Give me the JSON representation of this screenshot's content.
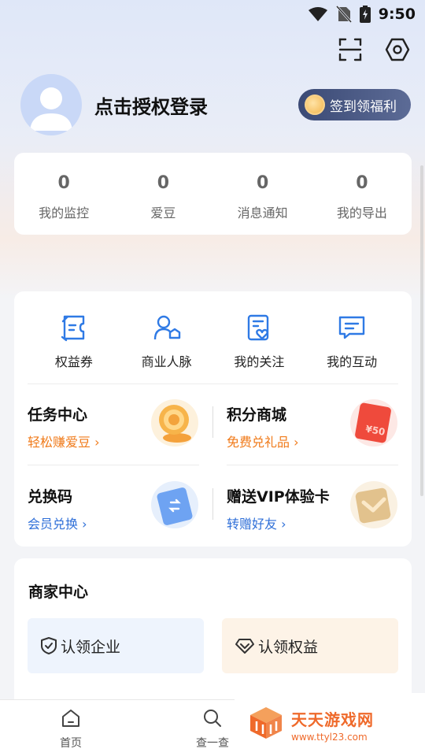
{
  "status_bar": {
    "time": "9:50",
    "icons": [
      "wifi-icon",
      "no-sim-icon",
      "battery-icon"
    ]
  },
  "header": {
    "icons": [
      "scan-icon",
      "settings-icon"
    ],
    "login_text": "点击授权登录",
    "signin_label": "签到领福利"
  },
  "stats": [
    {
      "value": "0",
      "label": "我的监控"
    },
    {
      "value": "0",
      "label": "爱豆"
    },
    {
      "value": "0",
      "label": "消息通知"
    },
    {
      "value": "0",
      "label": "我的导出"
    }
  ],
  "quick_actions": [
    {
      "label": "权益券",
      "icon": "coupon-icon"
    },
    {
      "label": "商业人脉",
      "icon": "contacts-icon"
    },
    {
      "label": "我的关注",
      "icon": "follow-icon"
    },
    {
      "label": "我的互动",
      "icon": "message-icon"
    }
  ],
  "promos": [
    {
      "title": "任务中心",
      "subtitle": "轻松赚爱豆 ›",
      "color": "#f07a19",
      "icon": "coin-stack-icon"
    },
    {
      "title": "积分商城",
      "subtitle": "免费兑礼品 ›",
      "color": "#f07a19",
      "icon": "red-voucher-icon",
      "badge": "¥50"
    },
    {
      "title": "兑换码",
      "subtitle": "会员兑换 ›",
      "color": "#2f6fd8",
      "icon": "exchange-card-icon"
    },
    {
      "title": "赠送VIP体验卡",
      "subtitle": "转赠好友 ›",
      "color": "#2f6fd8",
      "icon": "vip-card-icon"
    }
  ],
  "merchant": {
    "title": "商家中心",
    "buttons": [
      {
        "label": "认领企业",
        "icon": "shield-check-icon",
        "bg": "#eef4fd"
      },
      {
        "label": "认领权益",
        "icon": "diamond-icon",
        "bg": "#fdf3e7"
      }
    ]
  },
  "bottom_nav": [
    {
      "label": "首页",
      "icon": "home-icon"
    },
    {
      "label": "查一查",
      "icon": "search-icon"
    }
  ],
  "watermark": {
    "title": "天天游戏网",
    "url": "www.ttyl23.com"
  }
}
